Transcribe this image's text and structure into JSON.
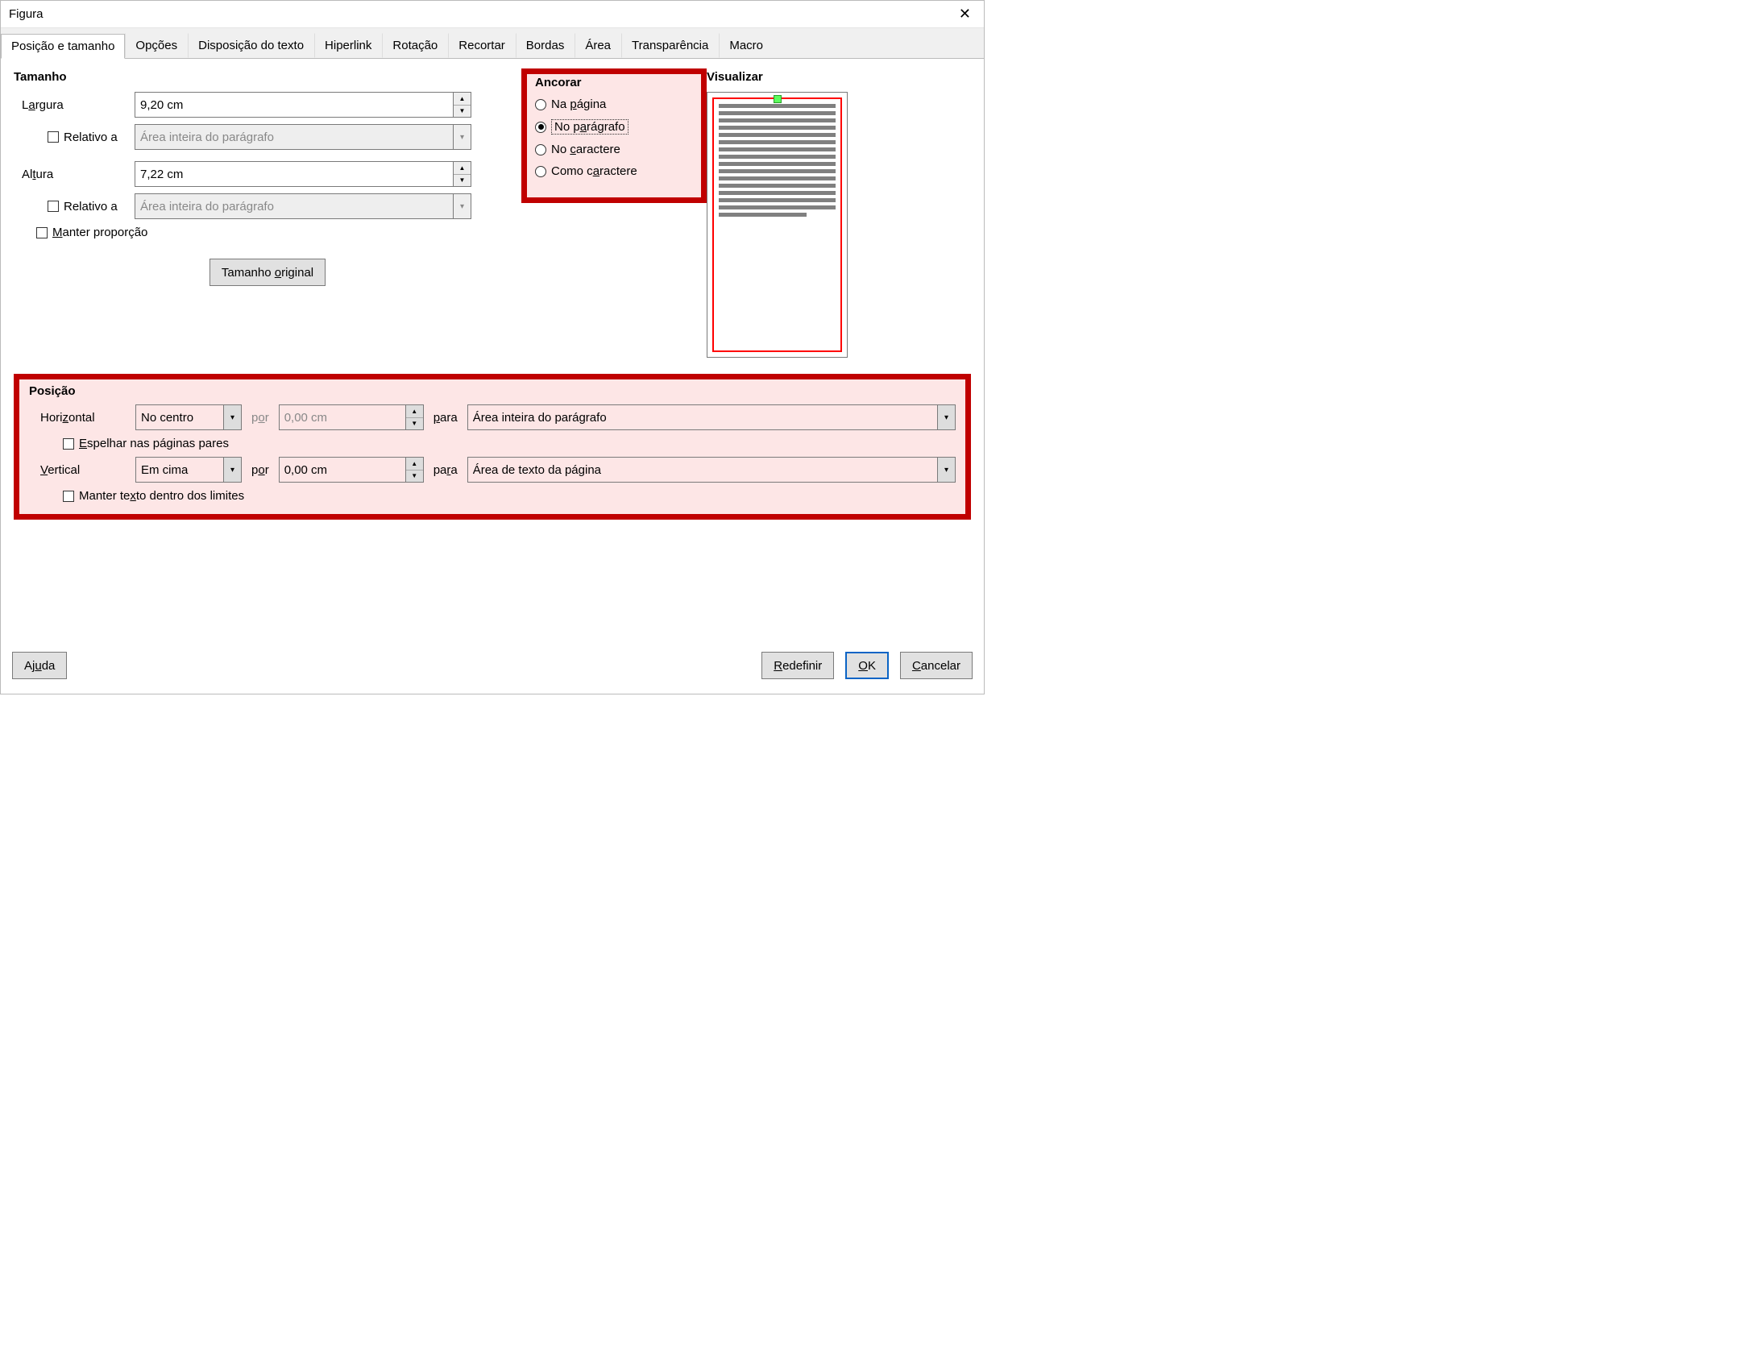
{
  "titlebar": {
    "title": "Figura"
  },
  "tabs": {
    "t0": "Posição e tamanho",
    "t1": "Opções",
    "t2": "Disposição do texto",
    "t3": "Hiperlink",
    "t4": "Rotação",
    "t5": "Recortar",
    "t6": "Bordas",
    "t7": "Área",
    "t8": "Transparência",
    "t9": "Macro"
  },
  "size": {
    "title": "Tamanho",
    "width_label_pre": "L",
    "width_label_u": "a",
    "width_label_post": "rgura",
    "width_value": "9,20 cm",
    "height_label_pre": "Al",
    "height_label_u": "t",
    "height_label_post": "ura",
    "height_value": "7,22 cm",
    "relative_label": "Relativo a",
    "relative_combo_placeholder": "Área inteira do parágrafo",
    "keep_ratio_pre": "",
    "keep_ratio_u": "M",
    "keep_ratio_post": "anter proporção",
    "original_btn_pre": "Tamanho ",
    "original_btn_u": "o",
    "original_btn_post": "riginal"
  },
  "anchor": {
    "title": "Ancorar",
    "r1_pre": "Na ",
    "r1_u": "p",
    "r1_post": "ágina",
    "r2_pre": "No p",
    "r2_u": "a",
    "r2_post": "rágrafo",
    "r3_pre": "No ",
    "r3_u": "c",
    "r3_post": "aractere",
    "r4_pre": "Como c",
    "r4_u": "a",
    "r4_post": "ractere"
  },
  "preview": {
    "title": "Visualizar"
  },
  "position": {
    "title": "Posição",
    "horiz_label_pre": "Hori",
    "horiz_label_u": "z",
    "horiz_label_post": "ontal",
    "horiz_value": "No centro",
    "by_pre": "p",
    "by_u": "o",
    "by_post": "r",
    "horiz_by_value": "0,00 cm",
    "to_pre": "",
    "to_u": "p",
    "to_post": "ara",
    "to2_pre": "pa",
    "to2_u": "r",
    "to2_post": "a",
    "horiz_to_value": "Área inteira do parágrafo",
    "mirror_pre": "",
    "mirror_u": "E",
    "mirror_post": "spelhar nas páginas pares",
    "vert_label_pre": "",
    "vert_label_u": "V",
    "vert_label_post": "ertical",
    "vert_value": "Em cima",
    "vert_by_value": "0,00 cm",
    "vert_to_value": "Área de texto da página",
    "keeptxt_pre1": "Manter te",
    "keeptxt_u": "x",
    "keeptxt_post": "to dentro dos limites"
  },
  "footer": {
    "help_pre": "Aj",
    "help_u": "u",
    "help_post": "da",
    "reset_pre": "",
    "reset_u": "R",
    "reset_post": "edefinir",
    "ok_pre": "",
    "ok_u": "O",
    "ok_post": "K",
    "cancel_pre": "",
    "cancel_u": "C",
    "cancel_post": "ancelar"
  }
}
